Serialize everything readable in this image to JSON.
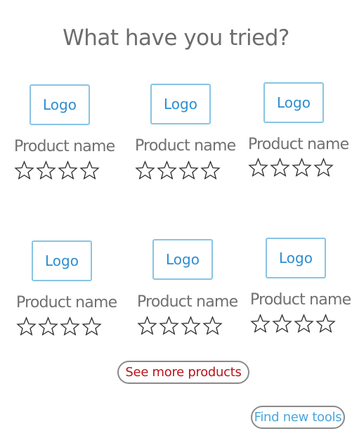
{
  "page": {
    "title": "What have you tried?"
  },
  "products": [
    {
      "logo": "Logo",
      "name": "Product name",
      "rating": 0,
      "max_rating": 4
    },
    {
      "logo": "Logo",
      "name": "Product name",
      "rating": 0,
      "max_rating": 4
    },
    {
      "logo": "Logo",
      "name": "Product name",
      "rating": 0,
      "max_rating": 4
    },
    {
      "logo": "Logo",
      "name": "Product name",
      "rating": 0,
      "max_rating": 4
    },
    {
      "logo": "Logo",
      "name": "Product name",
      "rating": 0,
      "max_rating": 4
    },
    {
      "logo": "Logo",
      "name": "Product name",
      "rating": 0,
      "max_rating": 4
    }
  ],
  "actions": {
    "see_more_label": "See more products",
    "find_tools_label": "Find new tools"
  },
  "colors": {
    "title": "#6d6d6d",
    "logo_border": "#88c4e4",
    "logo_text": "#2d8ed0",
    "see_more_text": "#b8141a",
    "find_tools_text": "#4aa6dd"
  },
  "icons": {
    "rating_star": "star-outline-icon"
  }
}
